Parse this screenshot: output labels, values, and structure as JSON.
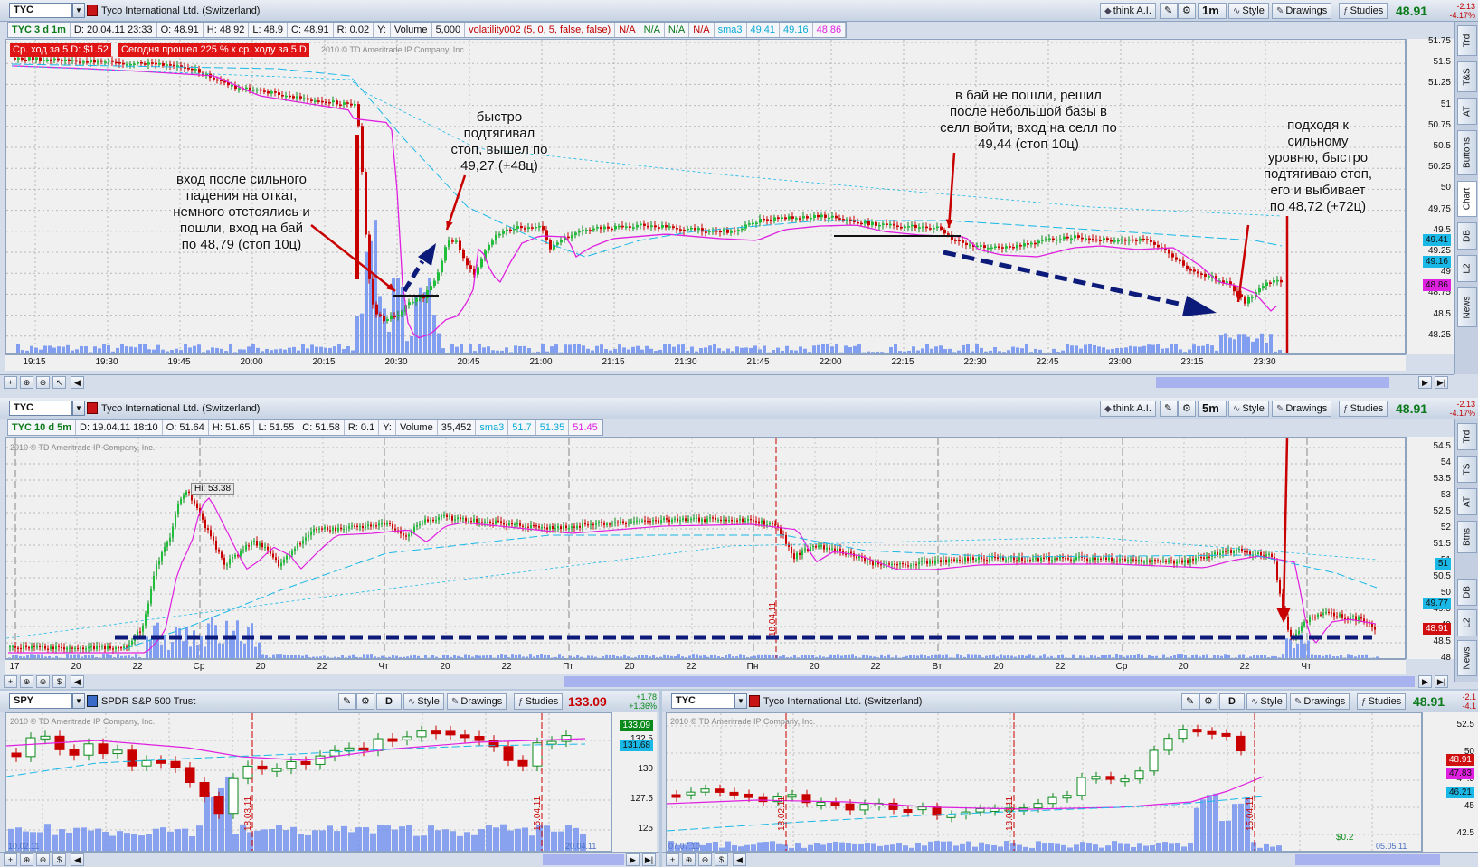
{
  "top": {
    "symbol": "TYC",
    "company": "Tyco International Ltd. (Switzerland)",
    "toolbar": {
      "think": "think A.I.",
      "interval": "1m",
      "style": "Style",
      "drawings": "Drawings",
      "studies": "Studies"
    },
    "price": "48.91",
    "change": "-2.13",
    "change_pct": "-4.17%",
    "info": {
      "sym": "TYC 3 d 1m",
      "d": "D: 20.04.11 23:33",
      "o": "O: 48.91",
      "h": "H: 48.92",
      "l": "L: 48.9",
      "c": "C: 48.91",
      "r": "R: 0.02",
      "y": "Y:",
      "vol_label": "Volume",
      "vol": "5,000",
      "volat": "volatility002 (5, 0, 5, false, false)",
      "na1": "N/A",
      "na2": "N/A",
      "na3": "N/A",
      "na4": "N/A",
      "sma": "sma3",
      "s1": "49.41",
      "s2": "49.16",
      "s3": "48.86"
    },
    "banner1": "Ср. ход за 5 D: $1.52",
    "banner2": "Сегодня прошел 225 % к ср. ходу за 5 D",
    "copyright": "2010 © TD Ameritrade IP Company, Inc.",
    "yticks": [
      "51.75",
      "51.5",
      "51.25",
      "51",
      "50.75",
      "50.5",
      "50.25",
      "50",
      "49.75",
      "49.5",
      "49.25",
      "49",
      "48.75",
      "48.5",
      "48.25"
    ],
    "xticks": [
      "19:15",
      "19:30",
      "19:45",
      "20:00",
      "20:15",
      "20:30",
      "20:45",
      "21:00",
      "21:15",
      "21:30",
      "21:45",
      "22:00",
      "22:15",
      "22:30",
      "22:45",
      "23:00",
      "23:15",
      "23:30"
    ],
    "labels": {
      "l1": "49.41",
      "l2": "49.16",
      "l3": "48.86"
    },
    "annotations": {
      "a1": "вход после сильного\nпадения на откат,\nнемного отстоялись и\nпошли, вход на бай\nпо 48,79 (стоп 10ц)",
      "a2": "быстро\nподтягивал\nстоп, вышел по\n49,27 (+48ц)",
      "a3": "в бай не пошли, решил\nпосле небольшой базы в\nселл войти, вход на селл по\n49,44 (стоп 10ц)",
      "a4": "подходя к\nсильному\nуровню, быстро\nподтягиваю стоп,\nего и выбивает\nпо 48,72 (+72ц)"
    },
    "sidetabs": [
      "Trd",
      "T&S",
      "AT",
      "Buttons",
      "Chart",
      "DB",
      "L2",
      "News"
    ]
  },
  "mid": {
    "symbol": "TYC",
    "company": "Tyco International Ltd. (Switzerland)",
    "toolbar": {
      "think": "think A.I.",
      "interval": "5m",
      "style": "Style",
      "drawings": "Drawings",
      "studies": "Studies"
    },
    "price": "48.91",
    "change": "-2.13",
    "change_pct": "-4.17%",
    "info": {
      "sym": "TYC 10 d 5m",
      "d": "D: 19.04.11 18:10",
      "o": "O: 51.64",
      "h": "H: 51.65",
      "l": "L: 51.55",
      "c": "C: 51.58",
      "r": "R: 0.1",
      "y": "Y:",
      "vol_label": "Volume",
      "vol": "35,452",
      "sma": "sma3",
      "s1": "51.7",
      "s2": "51.35",
      "s3": "51.45"
    },
    "copyright": "2010 © TD Ameritrade IP Company, Inc.",
    "hi": "Hi: 53.38",
    "vline_date": "18.04.11",
    "yticks": [
      "54.5",
      "54",
      "53.5",
      "53",
      "52.5",
      "52",
      "51.5",
      "51",
      "50.5",
      "50",
      "49.5",
      "49",
      "48.5",
      "48"
    ],
    "xticks": [
      "17",
      "20",
      "22",
      "Ср",
      "20",
      "22",
      "Чт",
      "20",
      "22",
      "Пт",
      "20",
      "22",
      "Пн",
      "20",
      "22",
      "Вт",
      "20",
      "22",
      "Ср",
      "20",
      "22",
      "Чт"
    ],
    "labels": {
      "l1": "51",
      "l2": "49.77",
      "l3": "48.91"
    },
    "sidetabs": [
      "Trd",
      "TS",
      "AT",
      "Btns",
      "DB",
      "L2",
      "News"
    ]
  },
  "bl": {
    "symbol": "SPY",
    "company": "SPDR S&P 500 Trust",
    "toolbar": {
      "interval": "D",
      "style": "Style",
      "drawings": "Drawings",
      "studies": "Studies"
    },
    "price": "133.09",
    "change": "+1.78",
    "change_pct": "+1.36%",
    "copyright": "2010 © TD Ameritrade IP Company, Inc.",
    "yticks": [
      "132.5",
      "130",
      "127.5",
      "125"
    ],
    "labels": {
      "l1": "133.09",
      "l2": "131.68"
    },
    "vdates": [
      "18.03.11",
      "15.04.11"
    ],
    "corner_left": "10.02.11",
    "corner_right": "20.04.11"
  },
  "br": {
    "symbol": "TYC",
    "company": "Tyco International Ltd. (Switzerland)",
    "toolbar": {
      "interval": "D",
      "style": "Style",
      "drawings": "Drawings",
      "studies": "Studies"
    },
    "price": "48.91",
    "change": "-2.1",
    "change_pct": "-4.1",
    "copyright": "2010 © TD Ameritrade IP Company, Inc.",
    "yticks": [
      "52.5",
      "50",
      "47.5",
      "45",
      "42.5"
    ],
    "labels": {
      "l1": "48.91",
      "l2": "47.83",
      "l3": "46.21"
    },
    "vdates": [
      "18.02.11",
      "18.03.11",
      "15.04.11"
    ],
    "corner_left": "07.07.10",
    "corner_right": "05.05.11",
    "small": "$0.2"
  },
  "colors": {
    "red": "#c80000",
    "navy": "#0c1a7a",
    "magenta": "#e020e0",
    "cyan": "#1ab8e6",
    "green": "#0a8a1a",
    "volume": "#6e8ff0"
  }
}
